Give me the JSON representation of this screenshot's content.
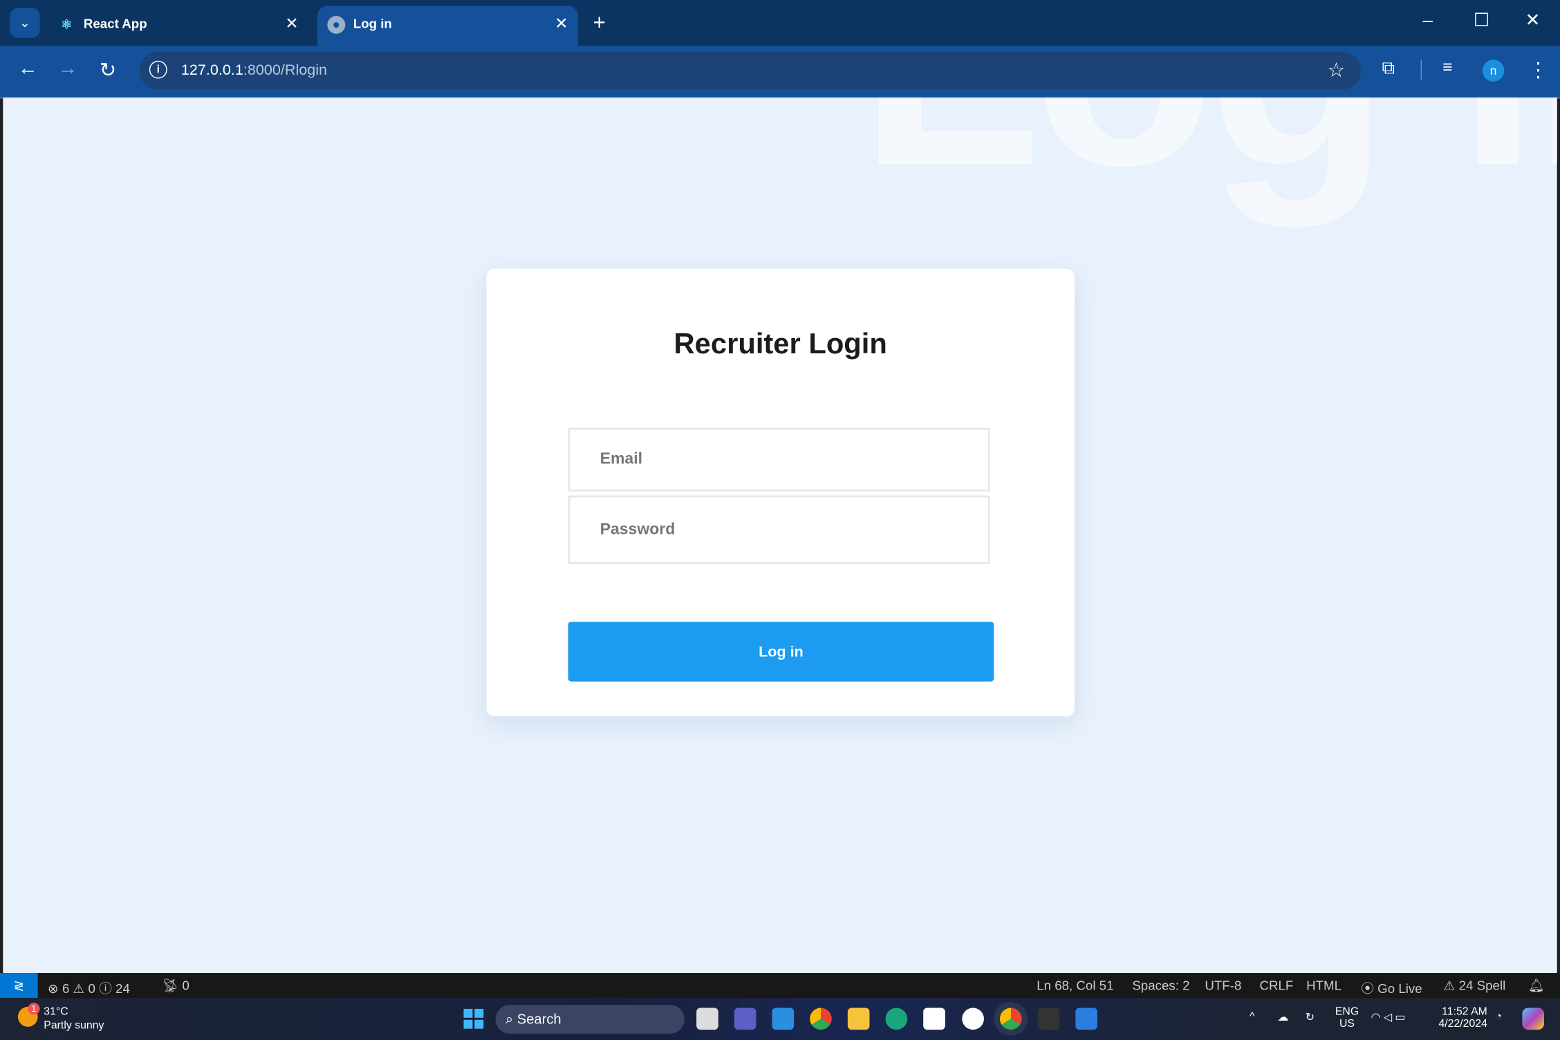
{
  "browser": {
    "tabs": [
      {
        "label": "React App",
        "icon": "react-icon",
        "active": false
      },
      {
        "label": "Log in",
        "icon": "globe-icon",
        "active": true
      }
    ],
    "url_host": "127.0.0.1",
    "url_rest": ":8000/Rlogin",
    "profile_initial": "n"
  },
  "page": {
    "watermark": "Log in",
    "title": "Recruiter Login",
    "email_placeholder": "Email",
    "password_placeholder": "Password",
    "login_button": "Log in",
    "accent_color": "#1d9bf0"
  },
  "statusbar": {
    "errors": "6",
    "warnings": "0",
    "infos": "24",
    "ports": "0",
    "position": "Ln 68, Col 51",
    "spaces": "Spaces: 2",
    "encoding": "UTF-8",
    "eol": "CRLF",
    "language": "HTML",
    "go_live": "Go Live",
    "spell": "24 Spell"
  },
  "taskbar": {
    "weather_temp": "31°C",
    "weather_desc": "Partly sunny",
    "weather_badge": "1",
    "search": "Search",
    "lang": "ENG",
    "region": "US",
    "time": "11:52 AM",
    "date": "4/22/2024"
  }
}
